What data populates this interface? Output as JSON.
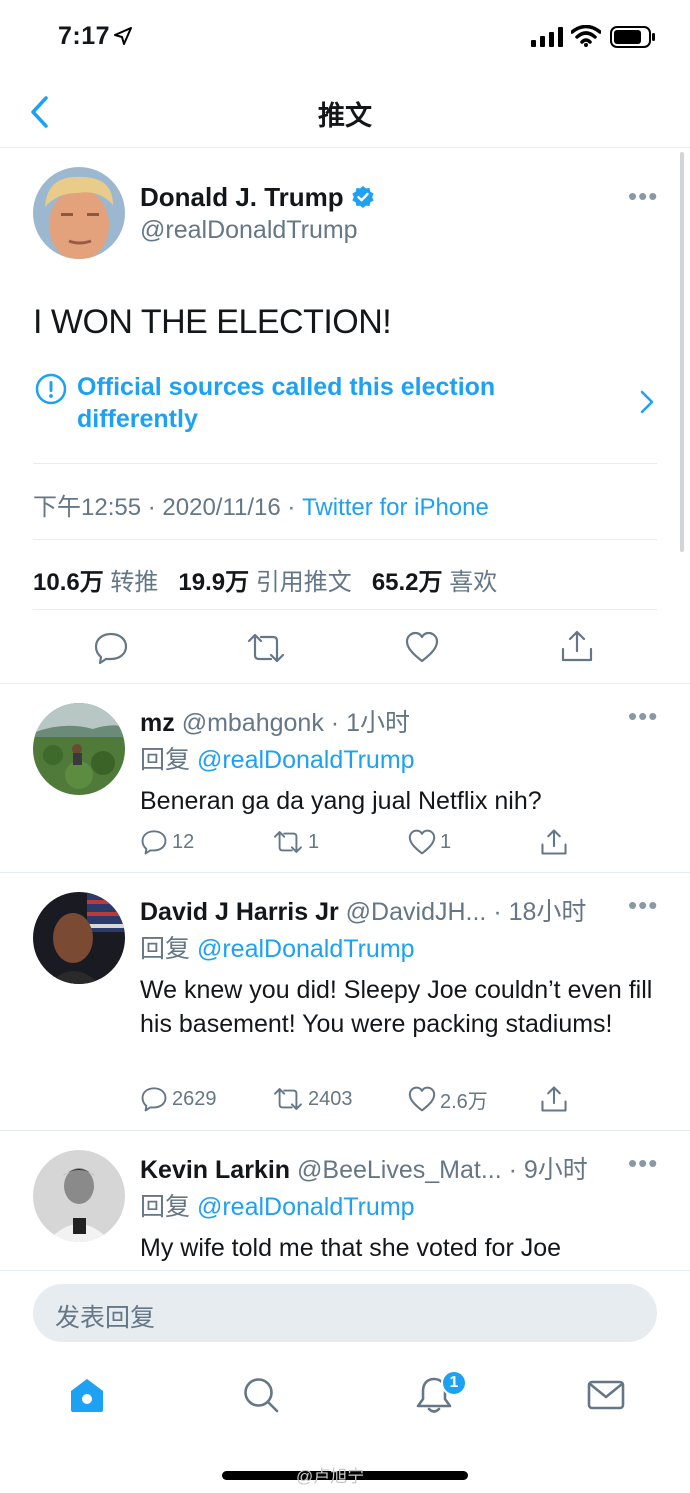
{
  "status_bar": {
    "time": "7:17"
  },
  "header": {
    "title": "推文"
  },
  "main_tweet": {
    "author_name": "Donald J. Trump",
    "author_handle": "@realDonaldTrump",
    "text": "I WON THE ELECTION!",
    "notice": "Official sources called this election differently",
    "time": "下午12:55",
    "date": "2020/11/16",
    "source": "Twitter for iPhone",
    "stats": {
      "retweets_count": "10.6万",
      "retweets_label": "转推",
      "quotes_count": "19.9万",
      "quotes_label": "引用推文",
      "likes_count": "65.2万",
      "likes_label": "喜欢"
    }
  },
  "replies": [
    {
      "name": "mz",
      "handle": "@mbahgonk",
      "time": "1小时",
      "reply_prefix": "回复",
      "reply_to": "@realDonaldTrump",
      "text": "Beneran ga da yang jual Netflix nih?",
      "comments": "12",
      "retweets": "1",
      "likes": "1"
    },
    {
      "name": "David J Harris Jr",
      "handle": "@DavidJH...",
      "time": "18小时",
      "reply_prefix": "回复",
      "reply_to": "@realDonaldTrump",
      "text": "We knew you did! Sleepy Joe couldn’t even fill his basement! You were packing stadiums!",
      "comments": "2629",
      "retweets": "2403",
      "likes": "2.6万"
    },
    {
      "name": "Kevin Larkin",
      "handle": "@BeeLives_Mat...",
      "time": "9小时",
      "reply_prefix": "回复",
      "reply_to": "@realDonaldTrump",
      "text": "My wife told me that she voted for Joe"
    }
  ],
  "compose": {
    "placeholder": "发表回复"
  },
  "tab_bar": {
    "notifications_badge": "1"
  },
  "watermark": "@卢旭宁",
  "colors": {
    "accent": "#1da1f2",
    "secondary_text": "#657786",
    "divider": "#e6ecf0"
  },
  "icons": [
    "location-arrow-icon",
    "signal-icon",
    "wifi-icon",
    "battery-icon",
    "back-chevron-icon",
    "verified-badge-icon",
    "more-icon",
    "info-icon",
    "chevron-right-icon",
    "reply-icon",
    "retweet-icon",
    "like-icon",
    "share-icon",
    "home-icon",
    "search-icon",
    "notifications-icon",
    "messages-icon"
  ]
}
